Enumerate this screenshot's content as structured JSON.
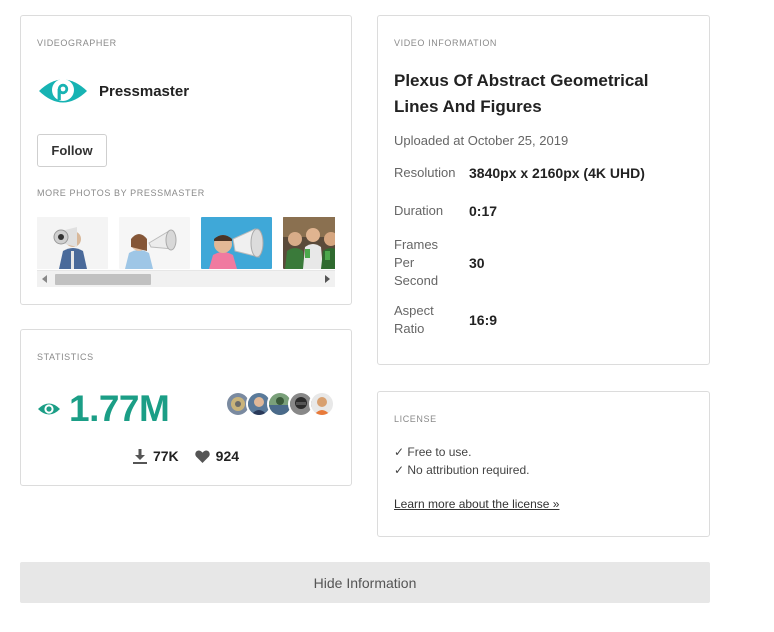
{
  "videographer": {
    "section_label": "VIDEOGRAPHER",
    "name": "Pressmaster",
    "logo_icon": "pressmaster-logo-icon",
    "follow_label": "Follow",
    "more_label": "MORE PHOTOS BY PRESSMASTER",
    "thumbnails": [
      "megaphone-man-photo",
      "woman-megaphone-photo",
      "man-megaphone-blue-photo",
      "friends-cheering-photo"
    ]
  },
  "statistics": {
    "section_label": "STATISTICS",
    "views": "1.77M",
    "downloads": "77K",
    "likes": "924",
    "accent_color": "#1b9e86"
  },
  "info": {
    "section_label": "VIDEO INFORMATION",
    "title": "Plexus Of Abstract Geometrical Lines And Figures",
    "uploaded": "Uploaded at October 25, 2019",
    "rows": [
      {
        "label": "Resolution",
        "value": "3840px x 2160px (4K UHD)"
      },
      {
        "label": "Duration",
        "value": "0:17"
      },
      {
        "label": "Frames Per Second",
        "value": "30"
      },
      {
        "label": "Aspect Ratio",
        "value": "16:9"
      }
    ]
  },
  "license": {
    "section_label": "LICENSE",
    "line1": "✓ Free to use.",
    "line2": "✓ No attribution required.",
    "link": "Learn more about the license »"
  },
  "hide_label": "Hide Information"
}
